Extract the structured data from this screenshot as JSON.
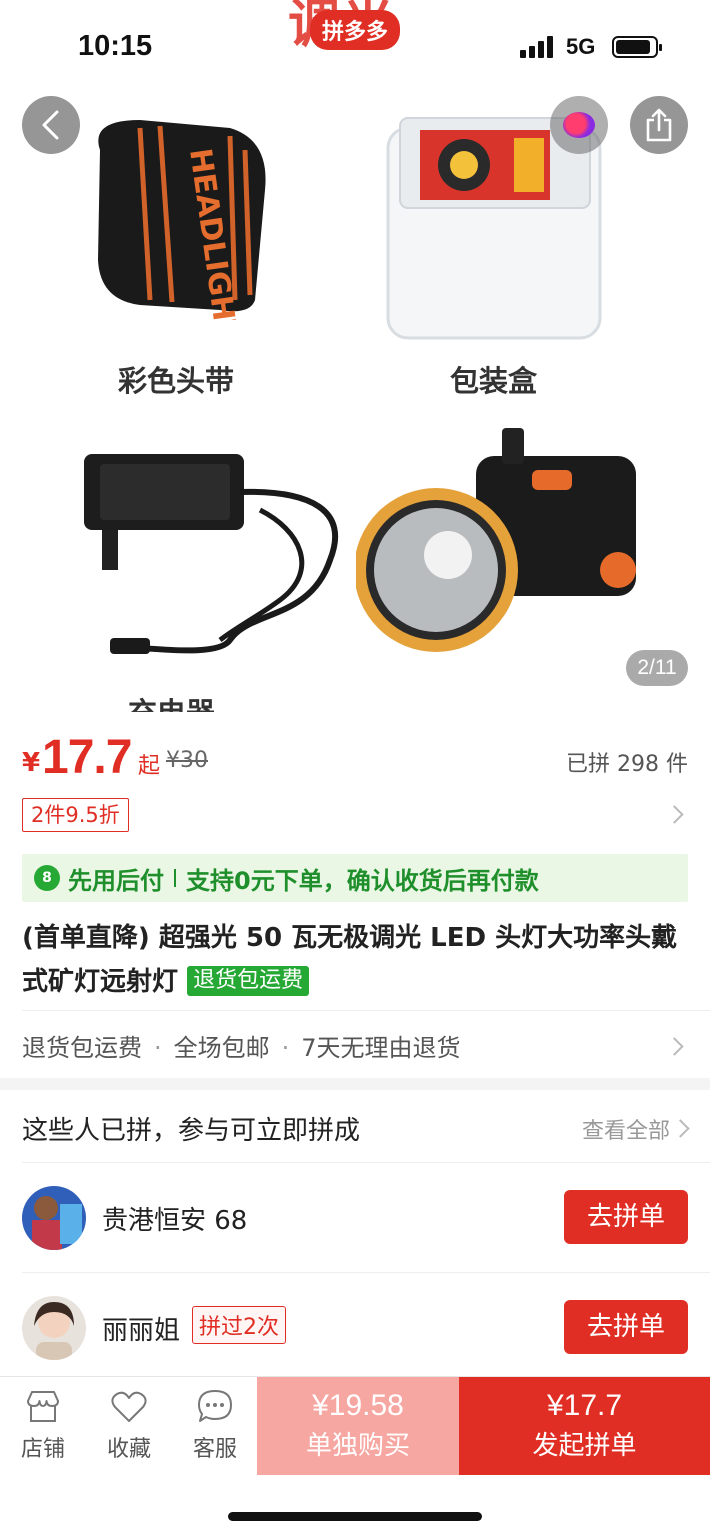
{
  "status_bar": {
    "time": "10:15",
    "network": "5G"
  },
  "header": {
    "logo_text": "调光",
    "brand_badge": "拼多多"
  },
  "gallery": {
    "tile_labels": [
      "彩色头带",
      "包装盒",
      "充电器"
    ],
    "page_indicator": "2/11"
  },
  "price": {
    "currency": "¥",
    "amount": "17.7",
    "suffix": "起",
    "original": "¥30",
    "sold": "已拼 298 件",
    "discount_tag": "2件9.5折"
  },
  "pay_later": {
    "icon_text": "8",
    "title": "先用后付",
    "text": "支持0元下单，确认收货后再付款"
  },
  "product": {
    "title": "(首单直降) 超强光 50 瓦无极调光 LED 头灯大功率头戴式矿灯远射灯",
    "badge": "退货包运费"
  },
  "services": {
    "items": [
      "退货包运费",
      "全场包邮",
      "7天无理由退货"
    ],
    "separator": "·"
  },
  "group_buy": {
    "heading": "这些人已拼，参与可立即拼成",
    "view_all": "查看全部",
    "members": [
      {
        "name": "贵港恒安 68",
        "joined": "",
        "button": "去拼单"
      },
      {
        "name": "丽丽姐",
        "joined": "拼过2次",
        "button": "去拼单"
      }
    ]
  },
  "bottom_bar": {
    "tabs": [
      {
        "label": "店铺",
        "icon": "store-icon"
      },
      {
        "label": "收藏",
        "icon": "heart-icon"
      },
      {
        "label": "客服",
        "icon": "chat-icon"
      }
    ],
    "buy_solo": {
      "price": "¥19.58",
      "label": "单独购买"
    },
    "buy_group": {
      "price": "¥17.7",
      "label": "发起拼单"
    }
  },
  "colors": {
    "accent": "#e02e24",
    "green": "#26a834",
    "solo_button": "#f7a7a2"
  }
}
